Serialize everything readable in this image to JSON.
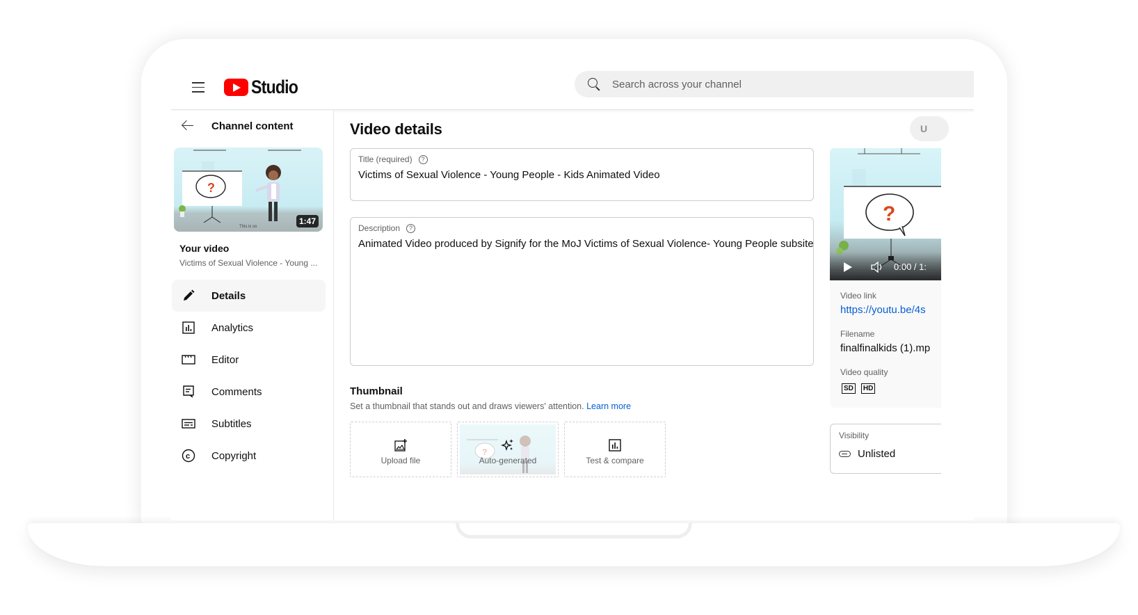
{
  "app": {
    "name": "Studio",
    "menu_icon": "hamburger-menu-icon",
    "logo_icon": "youtube-play-logo-icon"
  },
  "search": {
    "placeholder": "Search across your channel",
    "value": ""
  },
  "sidebar": {
    "back_label": "Channel content",
    "video": {
      "duration": "1:47",
      "heading": "Your video",
      "title_truncated": "Victims of Sexual Violence - Young ..."
    },
    "items": [
      {
        "label": "Details",
        "icon": "pencil-icon",
        "active": true
      },
      {
        "label": "Analytics",
        "icon": "analytics-icon",
        "active": false
      },
      {
        "label": "Editor",
        "icon": "editor-clapper-icon",
        "active": false
      },
      {
        "label": "Comments",
        "icon": "comments-icon",
        "active": false
      },
      {
        "label": "Subtitles",
        "icon": "subtitles-icon",
        "active": false
      },
      {
        "label": "Copyright",
        "icon": "copyright-icon",
        "active": false
      }
    ]
  },
  "main": {
    "page_title": "Video details",
    "undo_chip_visible_text": "U",
    "title_field": {
      "label": "Title (required)",
      "value": "Victims of Sexual Violence - Young People - Kids Animated Video"
    },
    "description_field": {
      "label": "Description",
      "value": "Animated Video produced by Signify for the MoJ Victims of Sexual Violence- Young People subsite"
    },
    "thumbnail": {
      "heading": "Thumbnail",
      "subtitle": "Set a thumbnail that stands out and draws viewers' attention.",
      "learn_more": "Learn more",
      "options": [
        {
          "label": "Upload file",
          "icon": "add-image-icon"
        },
        {
          "label": "Auto-generated",
          "icon": "sparkle-icon"
        },
        {
          "label": "Test & compare",
          "icon": "analytics-icon"
        }
      ]
    }
  },
  "right_panel": {
    "player": {
      "time": "0:00 / 1:"
    },
    "video_link_label": "Video link",
    "video_link": "https://youtu.be/4s",
    "filename_label": "Filename",
    "filename": "finalfinalkids (1).mp",
    "quality_label": "Video quality",
    "quality_badges": [
      "SD",
      "HD"
    ],
    "visibility_label": "Visibility",
    "visibility_value": "Unlisted"
  },
  "colors": {
    "brand_red": "#ff0000",
    "link_blue": "#065fd4",
    "question_orange": "#d9471d"
  }
}
